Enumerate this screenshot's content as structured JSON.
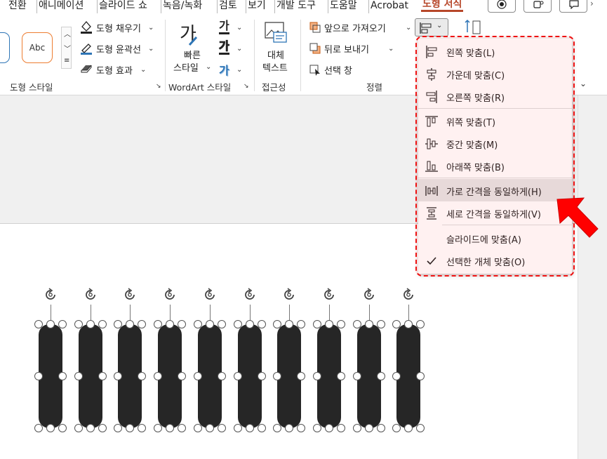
{
  "tabs": [
    "전환",
    "애니메이션",
    "슬라이드 쇼",
    "녹음/녹화",
    "검토",
    "보기",
    "개발 도구",
    "도움말",
    "Acrobat",
    "도형 서식"
  ],
  "active_tab": "도형 서식",
  "ribbon": {
    "style_sample": "Abc",
    "fill": "도형 채우기",
    "outline": "도형 윤곽선",
    "effect": "도형 효과",
    "group_shape_styles": "도형 스타일",
    "quick_style_top": "빠른",
    "quick_style_bottom": "스타일",
    "wordart_a1": "가",
    "wordart_a2": "가",
    "wordart_a3": "가",
    "group_wordart": "WordArt 스타일",
    "alt_text_top": "대체",
    "alt_text_bottom": "텍스트",
    "group_access": "접근성",
    "bring_forward": "앞으로 가져오기",
    "send_backward": "뒤로 보내기",
    "selection_pane": "선택 창",
    "group_arrange": "정렬"
  },
  "align_menu": {
    "items": [
      {
        "label": "왼쪽 맞춤(L)",
        "icon": "align-left-icon"
      },
      {
        "label": "가운데 맞춤(C)",
        "icon": "align-center-icon"
      },
      {
        "label": "오른쪽 맞춤(R)",
        "icon": "align-right-icon"
      },
      {
        "label": "위쪽 맞춤(T)",
        "icon": "align-top-icon"
      },
      {
        "label": "중간 맞춤(M)",
        "icon": "align-middle-icon"
      },
      {
        "label": "아래쪽 맞춤(B)",
        "icon": "align-bottom-icon"
      },
      {
        "label": "가로 간격을 동일하게(H)",
        "icon": "distribute-horizontal-icon"
      },
      {
        "label": "세로 간격을 동일하게(V)",
        "icon": "distribute-vertical-icon"
      },
      {
        "label": "슬라이드에 맞춤(A)",
        "icon": ""
      },
      {
        "label": "선택한 개체 맞춤(O)",
        "icon": "checkmark-icon"
      }
    ],
    "checked_item": "선택한 개체 맞춤(O)",
    "hovered_item": "가로 간격을 동일하게(H)"
  },
  "shapes": {
    "count": 10,
    "fill": "#262626"
  },
  "colors": {
    "accent": "#b7472a",
    "highlight": "#e11111",
    "arrow": "#ff0000"
  }
}
